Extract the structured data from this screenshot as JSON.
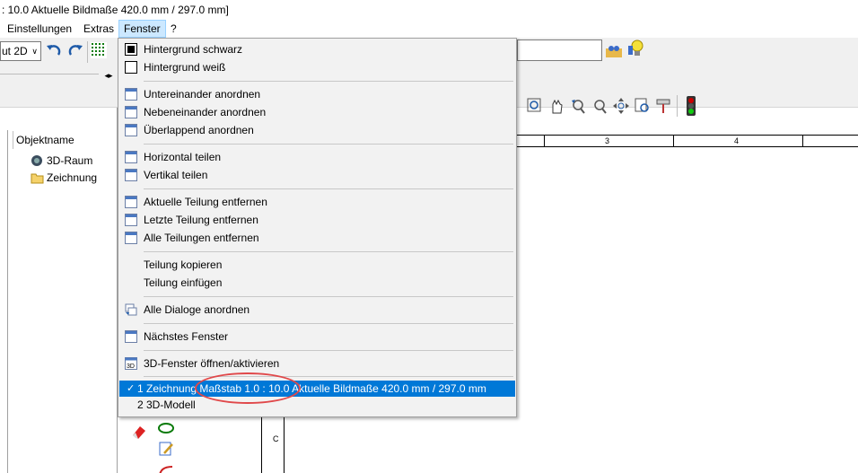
{
  "title": ": 10.0   Aktuelle Bildmaße 420.0 mm / 297.0 mm]",
  "menubar": {
    "items": [
      "Einstellungen",
      "Extras",
      "Fenster",
      "?"
    ]
  },
  "toolbar": {
    "view_combo": "ut 2D"
  },
  "tree": {
    "header": "Objektname",
    "items": [
      "3D-Raum",
      "Zeichnung"
    ]
  },
  "ruler": {
    "labels": [
      "3",
      "4"
    ],
    "side_label": "C"
  },
  "menu": {
    "items": [
      {
        "label": "Hintergrund schwarz",
        "icon": "checkbox-filled-icon"
      },
      {
        "label": "Hintergrund weiß",
        "icon": "checkbox-empty-icon"
      },
      {
        "label": "Untereinander anordnen",
        "icon": "tile-horizontal-icon"
      },
      {
        "label": "Nebeneinander anordnen",
        "icon": "tile-vertical-icon"
      },
      {
        "label": "Überlappend anordnen",
        "icon": "cascade-icon"
      },
      {
        "label": "Horizontal teilen",
        "icon": "split-horizontal-icon"
      },
      {
        "label": "Vertikal teilen",
        "icon": "split-vertical-icon"
      },
      {
        "label": "Aktuelle Teilung entfernen",
        "icon": "remove-split-icon"
      },
      {
        "label": "Letzte Teilung entfernen",
        "icon": "remove-last-split-icon"
      },
      {
        "label": "Alle Teilungen entfernen",
        "icon": "remove-all-splits-icon"
      },
      {
        "label": "Teilung kopieren",
        "icon": ""
      },
      {
        "label": "Teilung einfügen",
        "icon": ""
      },
      {
        "label": "Alle Dialoge anordnen",
        "icon": "arrange-dialogs-icon"
      },
      {
        "label": "Nächstes Fenster",
        "icon": "next-window-icon"
      },
      {
        "label": "3D-Fenster öffnen/aktivieren",
        "icon": "3d-window-icon"
      }
    ],
    "windows": [
      {
        "label": "1 Zeichnung   Maßstab 1.0 : 10.0   Aktuelle Bildmaße 420.0 mm / 297.0 mm",
        "checked": true
      },
      {
        "label": "2 3D-Modell",
        "checked": false
      }
    ]
  },
  "colors": {
    "selection": "#0078d7",
    "highlight_ellipse": "#e0484a",
    "menubar_active": "#cce8ff"
  }
}
